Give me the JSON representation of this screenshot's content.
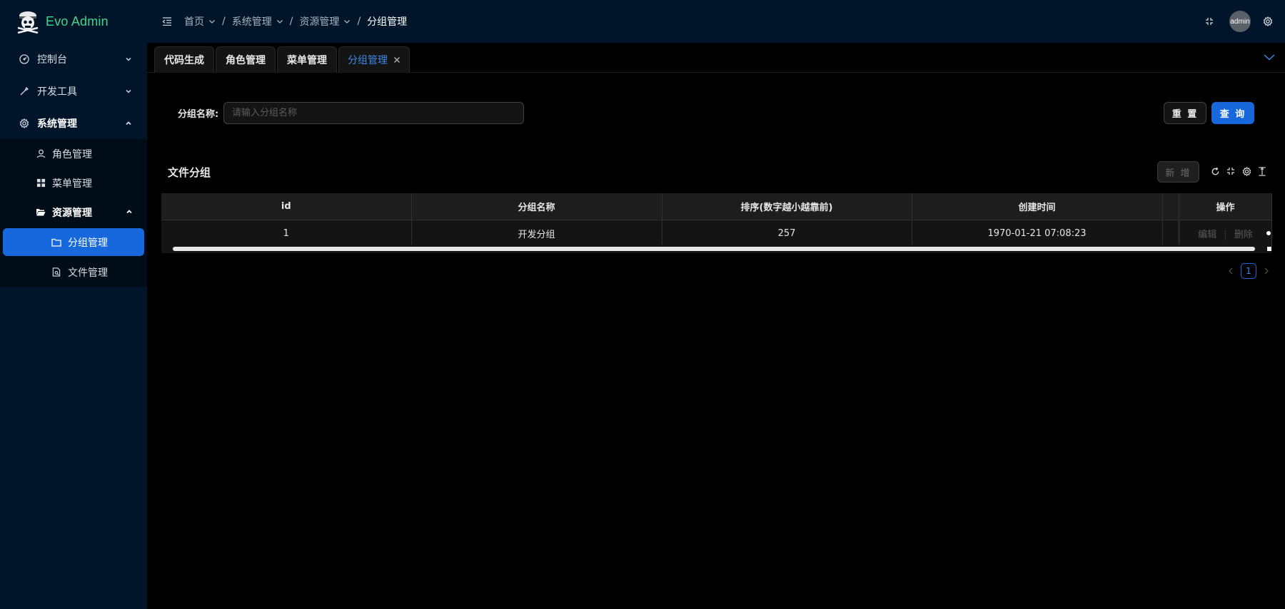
{
  "app": {
    "title": "Evo Admin",
    "accent": "#1668dc",
    "logo_color": "#3dd68c"
  },
  "sidebar": {
    "items": [
      {
        "label": "控制台",
        "icon": "dashboard-icon",
        "open": false
      },
      {
        "label": "开发工具",
        "icon": "tool-icon",
        "open": false
      },
      {
        "label": "系统管理",
        "icon": "gear-icon",
        "open": true,
        "children": [
          {
            "label": "角色管理",
            "icon": "user-icon"
          },
          {
            "label": "菜单管理",
            "icon": "grid-icon"
          },
          {
            "label": "资源管理",
            "icon": "folder-open-icon",
            "open": true,
            "children": [
              {
                "label": "分组管理",
                "icon": "folder-icon",
                "active": true
              },
              {
                "label": "文件管理",
                "icon": "file-search-icon"
              }
            ]
          }
        ]
      }
    ]
  },
  "header": {
    "breadcrumb": [
      {
        "label": "首页"
      },
      {
        "label": "系统管理"
      },
      {
        "label": "资源管理"
      },
      {
        "label": "分组管理"
      }
    ],
    "avatar_text": "admin"
  },
  "tabs": [
    {
      "label": "代码生成"
    },
    {
      "label": "角色管理"
    },
    {
      "label": "菜单管理"
    },
    {
      "label": "分组管理",
      "active": true
    }
  ],
  "search": {
    "label": "分组名称:",
    "placeholder": "请输入分组名称",
    "value": "",
    "reset_label": "重 置",
    "query_label": "查 询"
  },
  "table": {
    "title": "文件分组",
    "add_label": "新 增",
    "columns": [
      "id",
      "分组名称",
      "排序(数字越小越靠前)",
      "创建时间",
      "",
      "操作"
    ],
    "rows": [
      {
        "id": "1",
        "name": "开发分组",
        "sort": "257",
        "created": "1970-01-21 07:08:23"
      }
    ],
    "edit_label": "编辑",
    "delete_label": "删除"
  },
  "pagination": {
    "current": "1"
  }
}
